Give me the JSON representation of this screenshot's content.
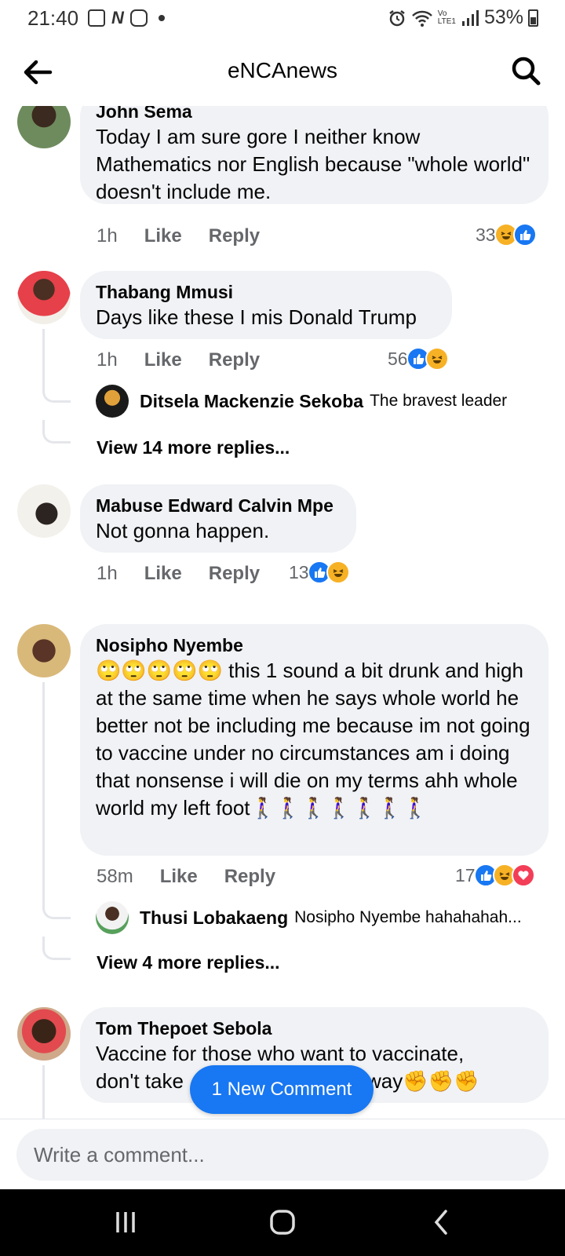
{
  "status_bar": {
    "time": "21:40",
    "battery": "53%"
  },
  "header": {
    "title": "eNCAnews"
  },
  "colors": {
    "accent": "#1877f2",
    "bubble": "#f0f2f5",
    "secondary_text": "#65676b"
  },
  "comments": [
    {
      "author": "John Sema",
      "text": "Today I am sure gore I neither know Mathematics nor English because \"whole world\" doesn't include me.",
      "time": "1h",
      "like_label": "Like",
      "reply_label": "Reply",
      "reaction_count": "33",
      "reactions": [
        "haha",
        "like"
      ]
    },
    {
      "author": "Thabang Mmusi",
      "text": "Days like these I mis Donald Trump",
      "time": "1h",
      "like_label": "Like",
      "reply_label": "Reply",
      "reaction_count": "56",
      "reactions": [
        "like",
        "haha"
      ],
      "top_reply": {
        "author": "Ditsela Mackenzie Sekoba",
        "text": "The bravest leader"
      },
      "view_more": "View 14 more replies..."
    },
    {
      "author": "Mabuse Edward Calvin Mpe",
      "text": "Not gonna happen.",
      "time": "1h",
      "like_label": "Like",
      "reply_label": "Reply",
      "reaction_count": "13",
      "reactions": [
        "like",
        "haha"
      ]
    },
    {
      "author": "Nosipho Nyembe",
      "text": "🙄🙄🙄🙄🙄 this 1 sound a bit drunk and high at the same time when he says whole world he better not be including me because im not going to vaccine under no circumstances am i doing that nonsense i will die on my terms ahh whole world my left foot🚶‍♀️🚶‍♀️🚶‍♀️🚶‍♀️🚶‍♀️🚶‍♀️🚶‍♀️",
      "time": "58m",
      "like_label": "Like",
      "reply_label": "Reply",
      "reaction_count": "17",
      "reactions": [
        "like",
        "haha",
        "love"
      ],
      "top_reply": {
        "author": "Thusi Lobakaeng",
        "text": "Nosipho Nyembe hahahahah..."
      },
      "view_more": "View 4 more replies..."
    },
    {
      "author": "Tom Thepoet Sebola",
      "text_line1": "Vaccine for those who want to vaccinate,",
      "text_line2_start": "don't take",
      "text_line2_end": "way✊✊✊"
    }
  ],
  "new_comment_pill": "1 New Comment",
  "composer": {
    "placeholder": "Write a comment..."
  }
}
